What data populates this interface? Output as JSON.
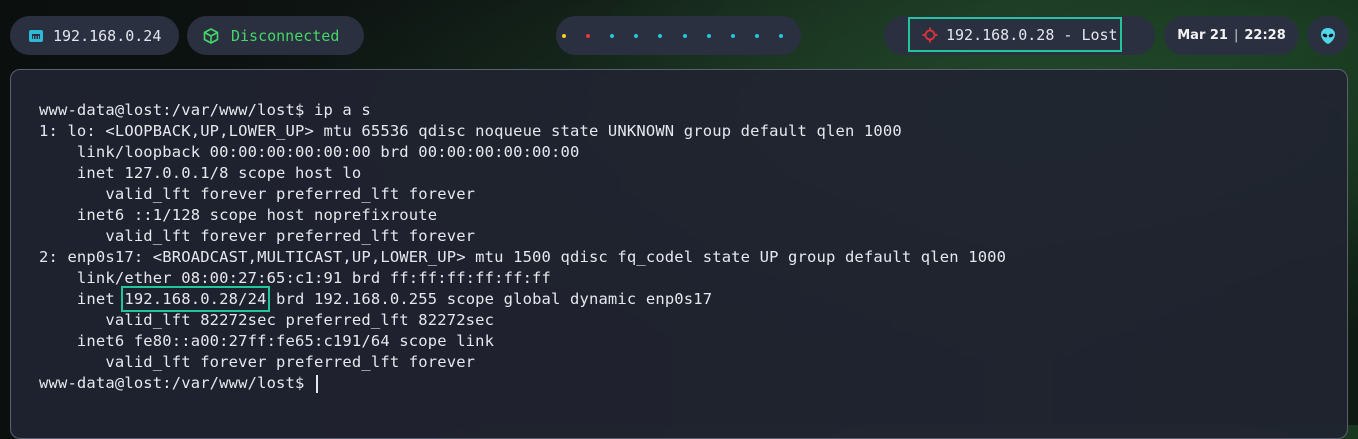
{
  "topbar": {
    "local_ip": "192.168.0.24",
    "vpn_status": "Disconnected",
    "target": "192.168.0.28 - Lost",
    "clock_date": "Mar 21",
    "clock_sep": "|",
    "clock_time": "22:28",
    "workspace_dots": [
      "#f2d02a",
      "#e03b3b",
      "#22c7d8",
      "#22c7d8",
      "#22c7d8",
      "#22c7d8",
      "#22c7d8",
      "#22c7d8",
      "#22c7d8",
      "#22c7d8"
    ]
  },
  "icons": {
    "ethernet": "ethernet-icon",
    "vpn": "cube-icon",
    "target": "crosshair-icon",
    "menu": "alien-icon"
  },
  "colors": {
    "accent": "#23c69a",
    "vpn_text": "#44d667",
    "target_icon": "#e0323a",
    "alien": "#4fd6e8"
  },
  "terminal": {
    "lines": [
      "www-data@lost:/var/www/lost$ ip a s",
      "1: lo: <LOOPBACK,UP,LOWER_UP> mtu 65536 qdisc noqueue state UNKNOWN group default qlen 1000",
      "    link/loopback 00:00:00:00:00:00 brd 00:00:00:00:00:00",
      "    inet 127.0.0.1/8 scope host lo",
      "       valid_lft forever preferred_lft forever",
      "    inet6 ::1/128 scope host noprefixroute",
      "       valid_lft forever preferred_lft forever",
      "2: enp0s17: <BROADCAST,MULTICAST,UP,LOWER_UP> mtu 1500 qdisc fq_codel state UP group default qlen 1000",
      "    link/ether 08:00:27:65:c1:91 brd ff:ff:ff:ff:ff:ff"
    ],
    "inet_prefix": "    inet ",
    "inet_addr": "192.168.0.28/24",
    "inet_suffix": " brd 192.168.0.255 scope global dynamic enp0s17",
    "tail_lines": [
      "       valid_lft 82272sec preferred_lft 82272sec",
      "    inet6 fe80::a00:27ff:fe65:c191/64 scope link",
      "       valid_lft forever preferred_lft forever"
    ],
    "prompt": "www-data@lost:/var/www/lost$ "
  }
}
